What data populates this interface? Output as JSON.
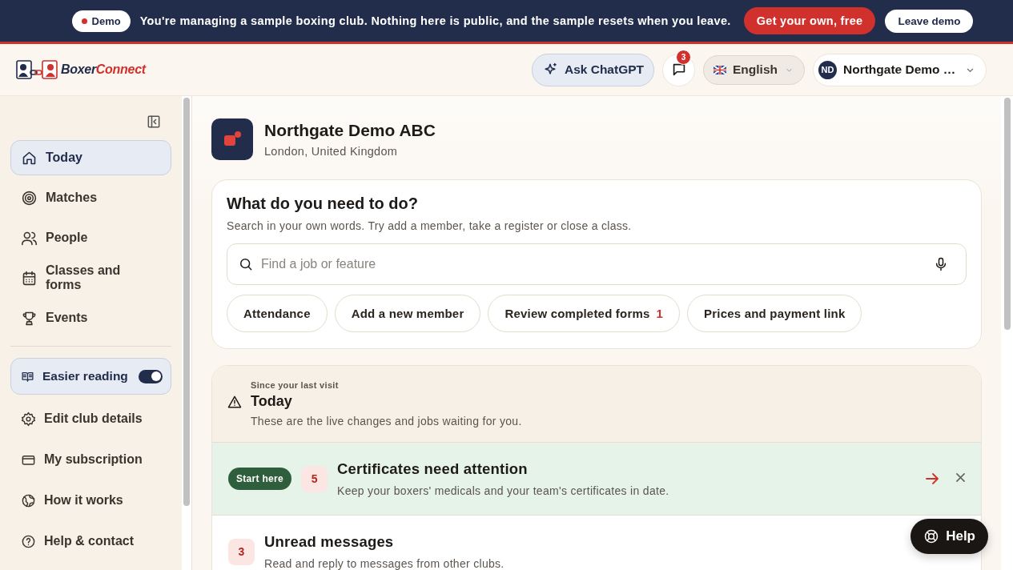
{
  "banner": {
    "badge": "Demo",
    "message": "You're managing a sample boxing club. Nothing here is public, and the sample resets when you leave.",
    "primary_button": "Get your own, free",
    "secondary_button": "Leave demo"
  },
  "header": {
    "logo": {
      "first": "Boxer",
      "second": "Connect"
    },
    "ask_button": "Ask ChatGPT",
    "messages_count": "3",
    "language": "English",
    "account": {
      "initials": "ND",
      "name": "Northgate Demo …"
    }
  },
  "sidebar": {
    "items": [
      {
        "label": "Today",
        "selected": true
      },
      {
        "label": "Matches",
        "selected": false
      },
      {
        "label": "People",
        "selected": false
      },
      {
        "label": "Classes and forms",
        "selected": false
      },
      {
        "label": "Events",
        "selected": false
      }
    ],
    "toggle": {
      "label": "Easier reading",
      "on": true
    },
    "links": [
      {
        "label": "Edit club details"
      },
      {
        "label": "My subscription"
      },
      {
        "label": "How it works"
      },
      {
        "label": "Help & contact"
      }
    ]
  },
  "club": {
    "name": "Northgate Demo ABC",
    "location": "London, United Kingdom"
  },
  "tasks": {
    "title": "What do you need to do?",
    "hint": "Search in your own words. Try add a member, take a register or close a class.",
    "search": {
      "placeholder": "Find a job or feature"
    },
    "chips": [
      {
        "label": "Attendance"
      },
      {
        "label": "Add a new member"
      },
      {
        "label": "Review completed forms",
        "count": "1"
      },
      {
        "label": "Prices and payment link"
      }
    ]
  },
  "today": {
    "eyebrow": "Since your last visit",
    "title": "Today",
    "text": "These are the live changes and jobs waiting for you.",
    "items": [
      {
        "tag": "Start here",
        "count": "5",
        "title": "Certificates need attention",
        "text": "Keep your boxers' medicals and your team's certificates in date.",
        "highlighted": true,
        "actions": true
      },
      {
        "count": "3",
        "title": "Unread messages",
        "text": "Read and reply to messages from other clubs.",
        "highlighted": false
      }
    ]
  },
  "help_button": "Help"
}
